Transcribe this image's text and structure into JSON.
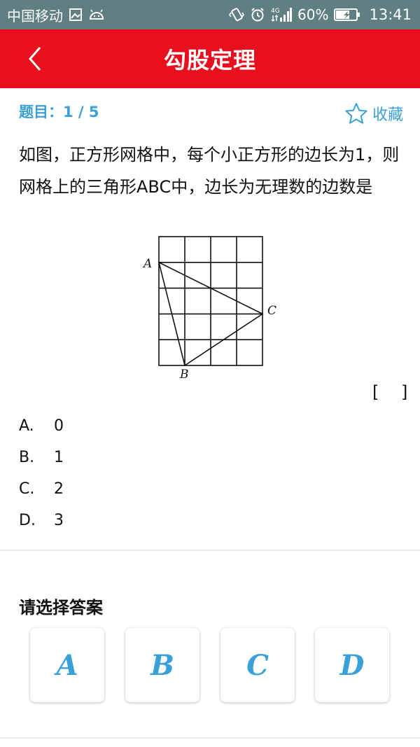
{
  "statusbar": {
    "carrier": "中国移动",
    "network": "4G",
    "battery": "60%",
    "time": "13:41"
  },
  "header": {
    "title": "勾股定理"
  },
  "question": {
    "number_label": "题目：1 / 5",
    "favorite_label": "收藏",
    "text": "如图，正方形网格中，每个小正方形的边长为1，则网格上的三角形ABC中，边长为无理数的边数是",
    "bracket": "[ ]",
    "figure_labels": {
      "a": "A",
      "b": "B",
      "c": "C"
    }
  },
  "options": [
    {
      "letter": "A.",
      "value": "0"
    },
    {
      "letter": "B.",
      "value": "1"
    },
    {
      "letter": "C.",
      "value": "2"
    },
    {
      "letter": "D.",
      "value": "3"
    }
  ],
  "answer_section": {
    "title": "请选择答案",
    "buttons": [
      "A",
      "B",
      "C",
      "D"
    ]
  },
  "colors": {
    "header": "#e8101e",
    "accent": "#3aa0d8",
    "statusbar": "#5f7f83"
  }
}
